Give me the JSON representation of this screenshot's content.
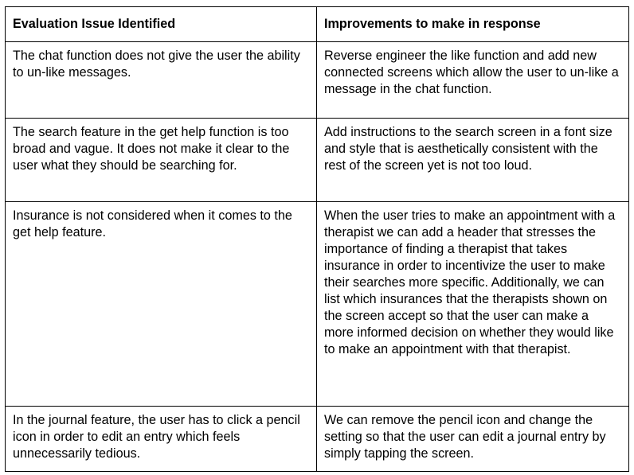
{
  "table": {
    "headers": [
      "Evaluation Issue Identified",
      "Improvements to make in response"
    ],
    "rows": [
      {
        "issue": "The chat function does not give the user the ability to un-like messages.",
        "improvement": "Reverse engineer the like function and add new connected screens which allow the user to un-like a message in the chat function."
      },
      {
        "issue": "The search feature in the get help function is too broad and vague. It does not make it clear to the user what they should be searching for.",
        "improvement": "Add instructions to the search screen in a font size and style that is aesthetically consistent with the rest of the screen yet is not too loud."
      },
      {
        "issue": "Insurance is not considered when it comes to the get help feature.",
        "improvement": "When the user tries to make an appointment with a therapist we can add a header that stresses the importance of finding a therapist that takes insurance in order to incentivize the user to make their searches more specific. Additionally, we can list which insurances that the therapists shown on the screen accept so that the user can make a more informed decision on whether they would like to make an appointment with that therapist."
      },
      {
        "issue": "In the journal feature, the user has to click a pencil icon in order to edit an entry which feels unnecessarily tedious.",
        "improvement": "We can remove the pencil icon and change the setting so that the user can edit a journal entry by simply tapping the screen."
      }
    ]
  }
}
